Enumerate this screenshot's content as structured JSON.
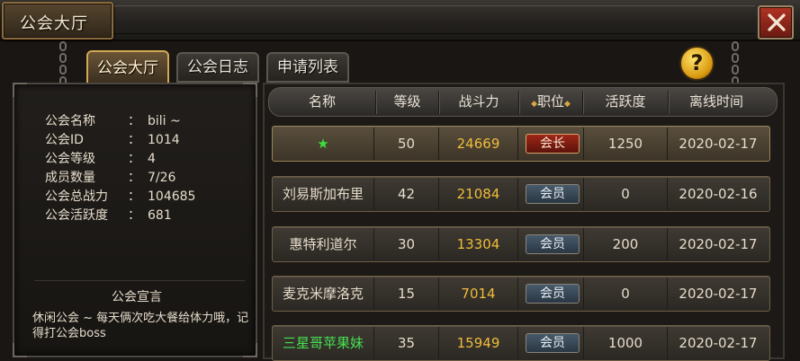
{
  "window": {
    "title": "公会大厅",
    "close_icon": "close-x-icon"
  },
  "tabs": [
    {
      "label": "公会大厅",
      "active": true
    },
    {
      "label": "公会日志",
      "active": false
    },
    {
      "label": "申请列表",
      "active": false
    }
  ],
  "help": {
    "label": "?"
  },
  "guild_info": {
    "rows": [
      {
        "key": "公会名称",
        "sep": "：",
        "value": "bili ~"
      },
      {
        "key": "公会ID",
        "sep": "：",
        "value": "1014"
      },
      {
        "key": "公会等级",
        "sep": "：",
        "value": "4"
      },
      {
        "key": "成员数量",
        "sep": "：",
        "value": "7/26"
      },
      {
        "key": "公会总战力",
        "sep": "：",
        "value": "104685"
      },
      {
        "key": "公会活跃度",
        "sep": "：",
        "value": "681"
      }
    ],
    "declaration_title": "公会宣言",
    "declaration_text": "休闲公会 ~ 每天俩次吃大餐给体力哦，记得打公会boss"
  },
  "members": {
    "headers": [
      "名称",
      "等级",
      "战斗力",
      "职位",
      "活跃度",
      "离线时间"
    ],
    "rows": [
      {
        "name": "★",
        "level": "50",
        "power": "24669",
        "position": "会长",
        "activity": "1250",
        "offline": "2020-02-17"
      },
      {
        "name": "刘易斯加布里",
        "level": "42",
        "power": "21084",
        "position": "会员",
        "activity": "0",
        "offline": "2020-02-16"
      },
      {
        "name": "惠特利道尔",
        "level": "30",
        "power": "13304",
        "position": "会员",
        "activity": "200",
        "offline": "2020-02-17"
      },
      {
        "name": "麦克米摩洛克",
        "level": "15",
        "power": "7014",
        "position": "会员",
        "activity": "0",
        "offline": "2020-02-17"
      },
      {
        "name": "三星哥苹果妹",
        "level": "35",
        "power": "15949",
        "position": "会员",
        "activity": "1000",
        "offline": "2020-02-17"
      }
    ]
  },
  "colors": {
    "power": "#f0bd3a",
    "leader_badge": "#9e2618",
    "member_badge": "#475a6a",
    "green_name": "#46e052"
  }
}
